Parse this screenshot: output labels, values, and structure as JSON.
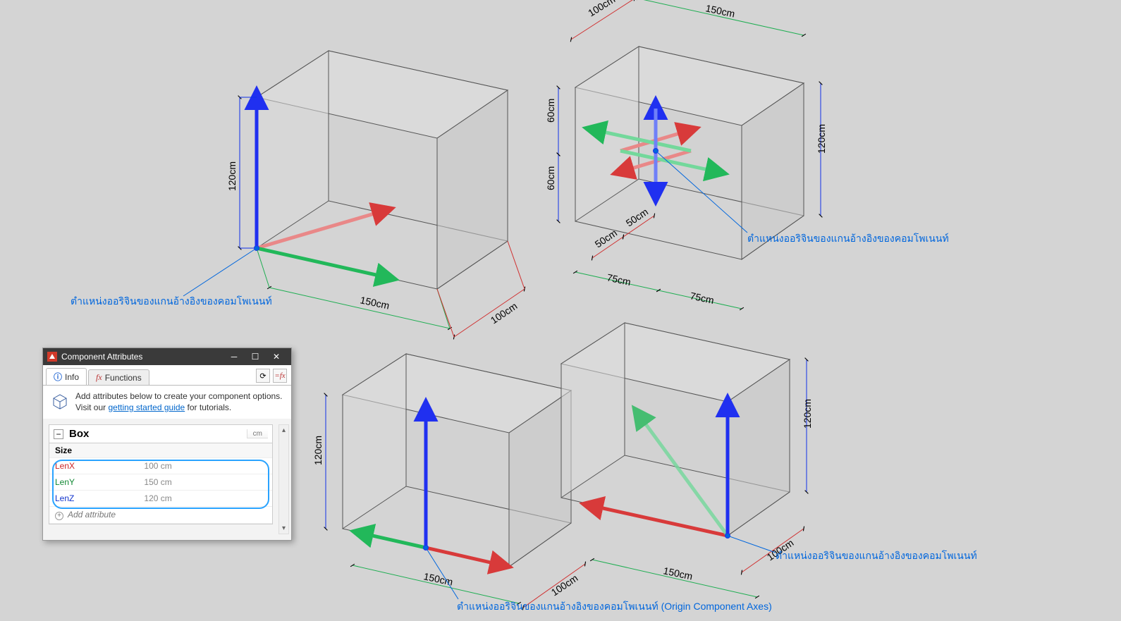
{
  "callouts": {
    "topleft": "ตำแหน่งออริจินของแกนอ้างอิงของคอมโพเนนท์",
    "topright": "ตำแหน่งออริจินของแกนอ้างอิงของคอมโพเนนท์",
    "botright": "ตำแหน่งออริจินของแกนอ้างอิงของคอมโพเนนท์",
    "botcenter": "ตำแหน่งออริจินของแกนอ้างอิงของคอมโพเนนท์ (Origin Component Axes)"
  },
  "dims": {
    "d100": "100cm",
    "d150": "150cm",
    "d120": "120cm",
    "d60": "60cm",
    "d50": "50cm",
    "d75": "75cm"
  },
  "panel": {
    "title": "Component Attributes",
    "tabs": {
      "info": "Info",
      "functions": "Functions"
    },
    "intro_a": "Add attributes below to create your component options. Visit our ",
    "intro_link": "getting started guide",
    "intro_b": " for tutorials.",
    "component_name": "Box",
    "unit": "cm",
    "size_label": "Size",
    "attrs": {
      "lenx_label": "LenX",
      "lenx_val": "100 cm",
      "leny_label": "LenY",
      "leny_val": "150 cm",
      "lenz_label": "LenZ",
      "lenz_val": "120 cm"
    },
    "add_attr": "Add attribute"
  },
  "colors": {
    "red": "#d83a3a",
    "green": "#22b85a",
    "blue": "#2030f0",
    "dimblue": "#1030e8",
    "dimred": "#d03030",
    "dimgreen": "#1fae52",
    "edge": "#555"
  }
}
